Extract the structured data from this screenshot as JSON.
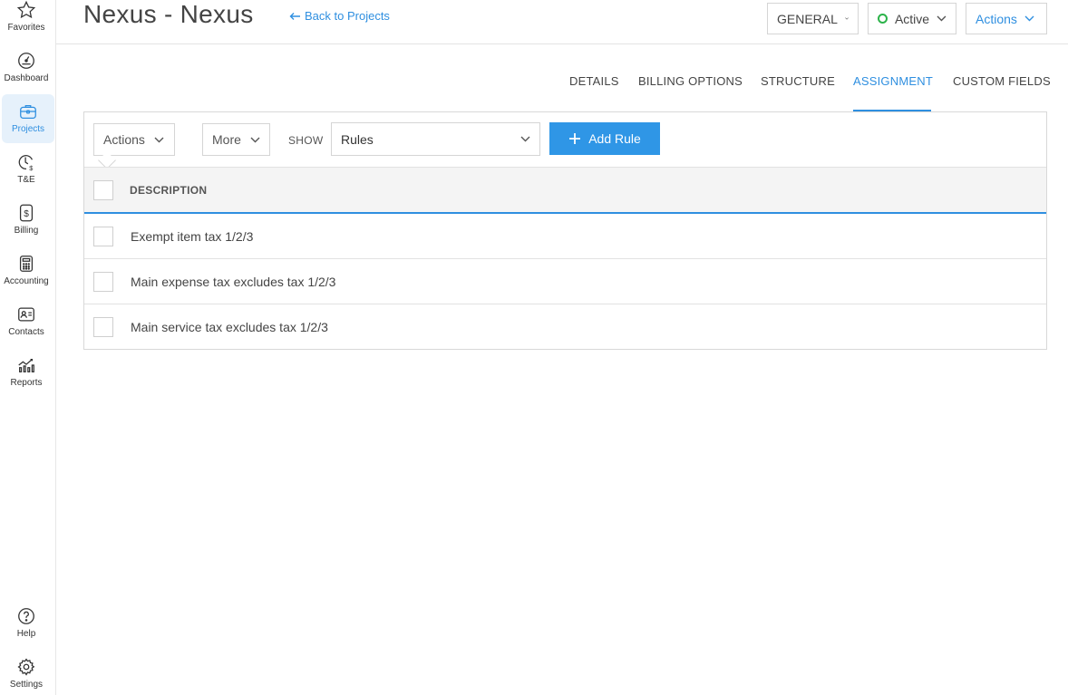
{
  "sidebar": {
    "items": [
      {
        "label": "Favorites",
        "icon": "star-icon"
      },
      {
        "label": "Dashboard",
        "icon": "gauge-icon"
      },
      {
        "label": "Projects",
        "icon": "briefcase-icon"
      },
      {
        "label": "T&E",
        "icon": "clock-dollar-icon"
      },
      {
        "label": "Billing",
        "icon": "invoice-dollar-icon"
      },
      {
        "label": "Accounting",
        "icon": "calculator-icon"
      },
      {
        "label": "Contacts",
        "icon": "contact-card-icon"
      },
      {
        "label": "Reports",
        "icon": "chart-icon"
      }
    ],
    "bottom": [
      {
        "label": "Help",
        "icon": "help-icon"
      },
      {
        "label": "Settings",
        "icon": "gear-icon"
      }
    ]
  },
  "header": {
    "title": "Nexus - Nexus",
    "back_link": "Back to Projects",
    "general_label": "GENERAL",
    "status_label": "Active",
    "actions_label": "Actions"
  },
  "tabs": [
    {
      "label": "DETAILS"
    },
    {
      "label": "BILLING OPTIONS"
    },
    {
      "label": "STRUCTURE"
    },
    {
      "label": "ASSIGNMENT"
    },
    {
      "label": "CUSTOM FIELDS"
    }
  ],
  "toolbar": {
    "actions_label": "Actions",
    "more_label": "More",
    "show_label": "SHOW",
    "show_value": "Rules",
    "add_rule_label": "Add Rule"
  },
  "table": {
    "column_header": "DESCRIPTION",
    "rows": [
      {
        "description": "Exempt item tax 1/2/3"
      },
      {
        "description": "Main expense tax excludes tax 1/2/3"
      },
      {
        "description": "Main service tax excludes tax 1/2/3"
      }
    ]
  },
  "colors": {
    "accent": "#2f8fe0",
    "button_primary": "#2f96e6",
    "status_active": "#2cb34a"
  }
}
